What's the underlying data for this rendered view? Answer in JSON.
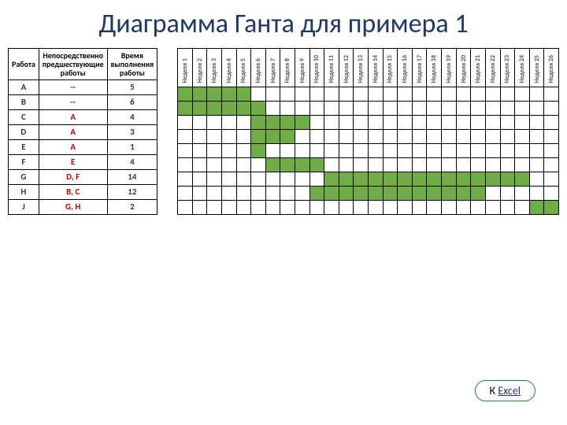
{
  "title": "Диаграмма Ганта для примера 1",
  "headers": {
    "task": "Работа",
    "pred": "Непосредственно предшествующие работы",
    "dur": "Время выполнения работы"
  },
  "weeks_label_prefix": "Неделя",
  "weeks": 26,
  "rows": [
    {
      "id": "A",
      "pred": "--",
      "dur": 5,
      "start": 1,
      "end": 5
    },
    {
      "id": "B",
      "pred": "--",
      "dur": 6,
      "start": 1,
      "end": 6
    },
    {
      "id": "C",
      "pred": "A",
      "dur": 4,
      "start": 6,
      "end": 9
    },
    {
      "id": "D",
      "pred": "A",
      "dur": 3,
      "start": 6,
      "end": 8
    },
    {
      "id": "E",
      "pred": "A",
      "dur": 1,
      "start": 6,
      "end": 6
    },
    {
      "id": "F",
      "pred": "E",
      "dur": 4,
      "start": 7,
      "end": 10
    },
    {
      "id": "G",
      "pred": "D, F",
      "dur": 14,
      "start": 11,
      "end": 24
    },
    {
      "id": "H",
      "pred": "B, C",
      "dur": 12,
      "start": 10,
      "end": 21
    },
    {
      "id": "J",
      "pred": "G, H",
      "dur": 2,
      "start": 25,
      "end": 26
    }
  ],
  "button": {
    "prefix": "К ",
    "link": "Excel"
  },
  "chart_data": {
    "type": "bar",
    "title": "Диаграмма Ганта для примера 1",
    "xlabel": "Неделя",
    "ylabel": "Работа",
    "xlim": [
      1,
      26
    ],
    "categories": [
      "A",
      "B",
      "C",
      "D",
      "E",
      "F",
      "G",
      "H",
      "J"
    ],
    "series": [
      {
        "name": "start",
        "values": [
          1,
          1,
          6,
          6,
          6,
          7,
          11,
          10,
          25
        ]
      },
      {
        "name": "duration",
        "values": [
          5,
          6,
          4,
          3,
          1,
          4,
          14,
          12,
          2
        ]
      }
    ]
  }
}
